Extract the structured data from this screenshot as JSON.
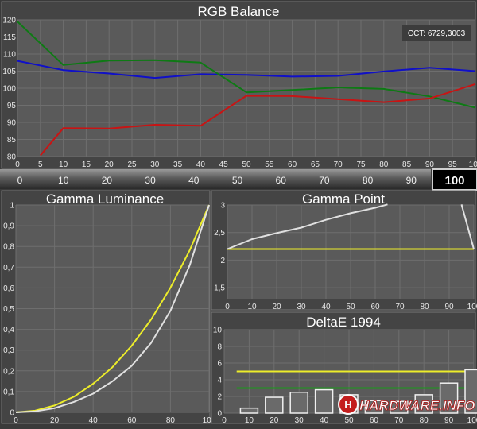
{
  "slider": {
    "ticks": [
      "0",
      "10",
      "20",
      "30",
      "40",
      "50",
      "60",
      "70",
      "80",
      "90"
    ],
    "value": "100"
  },
  "watermark": "HARDWARE.INFO",
  "chart_data": [
    {
      "id": "rgb",
      "type": "line",
      "title": "RGB Balance",
      "annotation": "CCT: 6729,3003",
      "x": [
        0,
        5,
        10,
        15,
        20,
        25,
        30,
        35,
        40,
        45,
        50,
        55,
        60,
        65,
        70,
        75,
        80,
        85,
        90,
        95,
        100
      ],
      "xticks": [
        "0",
        "5",
        "10",
        "15",
        "20",
        "25",
        "30",
        "35",
        "40",
        "45",
        "50",
        "55",
        "60",
        "65",
        "70",
        "75",
        "80",
        "85",
        "90",
        "95",
        "100"
      ],
      "yticks": [
        "80",
        "85",
        "90",
        "95",
        "100",
        "105",
        "110",
        "115",
        "120"
      ],
      "xlim": [
        0,
        100
      ],
      "ylim": [
        80,
        120
      ],
      "grid": true,
      "series": [
        {
          "color": "#1010c8",
          "points": [
            [
              0,
              108
            ],
            [
              10,
              105.3
            ],
            [
              20,
              104.3
            ],
            [
              30,
              103
            ],
            [
              40,
              104.1
            ],
            [
              50,
              103.9
            ],
            [
              60,
              103.4
            ],
            [
              70,
              103.6
            ],
            [
              80,
              104.9
            ],
            [
              90,
              106
            ],
            [
              100,
              105
            ]
          ]
        },
        {
          "color": "#0e7a14",
          "points": [
            [
              0,
              119.5
            ],
            [
              10,
              106.8
            ],
            [
              20,
              108.1
            ],
            [
              30,
              108.2
            ],
            [
              40,
              107.5
            ],
            [
              50,
              98.8
            ],
            [
              60,
              99.5
            ],
            [
              70,
              100.2
            ],
            [
              80,
              99.8
            ],
            [
              90,
              97.6
            ],
            [
              100,
              94.3
            ]
          ]
        },
        {
          "color": "#c81414",
          "points": [
            [
              5,
              80.3
            ],
            [
              10,
              88.3
            ],
            [
              20,
              88.2
            ],
            [
              30,
              89.3
            ],
            [
              40,
              89
            ],
            [
              50,
              97.8
            ],
            [
              60,
              97.7
            ],
            [
              70,
              96.8
            ],
            [
              80,
              95.9
            ],
            [
              90,
              97
            ],
            [
              100,
              101.2
            ]
          ]
        }
      ]
    },
    {
      "id": "gamma_lum",
      "type": "line",
      "title": "Gamma Luminance",
      "xticks": [
        "0",
        "20",
        "40",
        "60",
        "80",
        "100"
      ],
      "yticks": [
        "0",
        "0,1",
        "0,2",
        "0,3",
        "0,4",
        "0,5",
        "0,6",
        "0,7",
        "0,8",
        "0,9",
        "1"
      ],
      "xlim": [
        0,
        100
      ],
      "ylim": [
        0,
        1
      ],
      "grid": true,
      "series": [
        {
          "color": "#eded2a",
          "points": [
            [
              0,
              0
            ],
            [
              10,
              0.008
            ],
            [
              20,
              0.033
            ],
            [
              30,
              0.075
            ],
            [
              40,
              0.138
            ],
            [
              50,
              0.218
            ],
            [
              60,
              0.322
            ],
            [
              70,
              0.448
            ],
            [
              80,
              0.601
            ],
            [
              90,
              0.782
            ],
            [
              100,
              1
            ]
          ]
        },
        {
          "color": "#e0e0e0",
          "points": [
            [
              0,
              0
            ],
            [
              10,
              0.005
            ],
            [
              20,
              0.02
            ],
            [
              30,
              0.05
            ],
            [
              40,
              0.09
            ],
            [
              50,
              0.15
            ],
            [
              60,
              0.225
            ],
            [
              70,
              0.335
            ],
            [
              80,
              0.49
            ],
            [
              90,
              0.71
            ],
            [
              100,
              1
            ]
          ]
        }
      ]
    },
    {
      "id": "gamma_point",
      "type": "line",
      "title": "Gamma Point",
      "xticks": [
        "0",
        "10",
        "20",
        "30",
        "40",
        "50",
        "60",
        "70",
        "80",
        "90",
        "100"
      ],
      "yticks": [
        "1,5",
        "2",
        "2,5",
        "3"
      ],
      "xlim": [
        0,
        100
      ],
      "ylim": [
        1.3,
        3
      ],
      "grid": true,
      "series": [
        {
          "color": "#eded2a",
          "points": [
            [
              0,
              2.2
            ],
            [
              100,
              2.2
            ]
          ]
        },
        {
          "color": "#e0e0e0",
          "points": [
            [
              0,
              2.2
            ],
            [
              10,
              2.38
            ],
            [
              20,
              2.49
            ],
            [
              30,
              2.59
            ],
            [
              40,
              2.73
            ],
            [
              50,
              2.85
            ],
            [
              60,
              2.95
            ],
            [
              65,
              3.01
            ]
          ]
        },
        {
          "color": "#e0e0e0",
          "points": [
            [
              95,
              3.01
            ],
            [
              100,
              2.2
            ]
          ]
        }
      ]
    },
    {
      "id": "deltae",
      "type": "bar",
      "title": "DeltaE 1994",
      "xticks": [
        "0",
        "10",
        "20",
        "30",
        "40",
        "50",
        "60",
        "70",
        "80",
        "90",
        "100"
      ],
      "yticks": [
        "0",
        "2",
        "4",
        "6",
        "8",
        "10"
      ],
      "xlim": [
        0,
        100
      ],
      "ylim": [
        0,
        10
      ],
      "grid": true,
      "x": [
        10,
        20,
        30,
        40,
        50,
        60,
        70,
        80,
        90,
        100
      ],
      "values": [
        0.6,
        1.9,
        2.5,
        2.8,
        2.2,
        1.5,
        1.4,
        2.2,
        3.6,
        5.2
      ],
      "hlines": [
        {
          "y": 5,
          "color": "#eded2a"
        },
        {
          "y": 3,
          "color": "#1a9a1a"
        }
      ]
    }
  ]
}
